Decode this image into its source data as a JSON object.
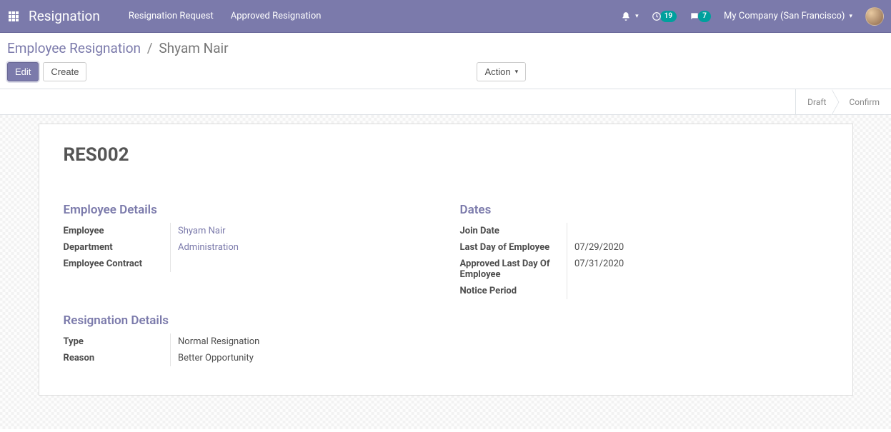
{
  "header": {
    "brand": "Resignation",
    "nav": [
      "Resignation Request",
      "Approved Resignation"
    ],
    "notif_badge_1": "19",
    "notif_badge_2": "7",
    "company": "My Company (San Francisco)"
  },
  "breadcrumb": {
    "root": "Employee Resignation",
    "current": "Shyam Nair"
  },
  "buttons": {
    "edit": "Edit",
    "create": "Create",
    "action": "Action"
  },
  "status": {
    "draft": "Draft",
    "confirm": "Confirm"
  },
  "record": {
    "name": "RES002",
    "employee_details_title": "Employee Details",
    "dates_title": "Dates",
    "resignation_details_title": "Resignation Details",
    "labels": {
      "employee": "Employee",
      "department": "Department",
      "contract": "Employee Contract",
      "join_date": "Join Date",
      "last_day": "Last Day of Employee",
      "approved_last_day": "Approved Last Day Of Employee",
      "notice_period": "Notice Period",
      "type": "Type",
      "reason": "Reason"
    },
    "values": {
      "employee": "Shyam Nair",
      "department": "Administration",
      "contract": "",
      "join_date": "",
      "last_day": "07/29/2020",
      "approved_last_day": "07/31/2020",
      "notice_period": "",
      "type": "Normal Resignation",
      "reason": "Better Opportunity"
    }
  }
}
